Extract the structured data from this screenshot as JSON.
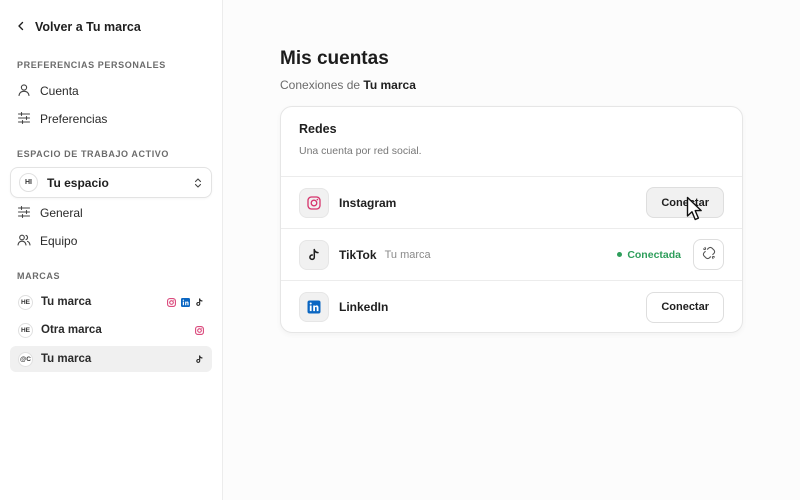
{
  "sidebar": {
    "back_label": "Volver a Tu marca",
    "personal_section": "PREFERENCIAS PERSONALES",
    "personal_items": [
      {
        "label": "Cuenta",
        "icon": "user-icon"
      },
      {
        "label": "Preferencias",
        "icon": "sliders-icon"
      }
    ],
    "workspace_section": "ESPACIO DE TRABAJO ACTIVO",
    "workspace": {
      "badge": "HI",
      "name": "Tu espacio"
    },
    "workspace_items": [
      {
        "label": "General",
        "icon": "sliders-icon"
      },
      {
        "label": "Equipo",
        "icon": "users-icon"
      }
    ],
    "brands_section": "MARCAS",
    "brands": [
      {
        "badge": "HE",
        "name": "Tu marca",
        "icons": [
          "instagram-icon",
          "linkedin-icon",
          "tiktok-icon"
        ]
      },
      {
        "badge": "HE",
        "name": "Otra marca",
        "icons": [
          "instagram-icon"
        ]
      },
      {
        "badge": "@C",
        "name": "Tu marca",
        "icons": [
          "tiktok-icon"
        ],
        "active": true
      }
    ]
  },
  "main": {
    "title": "Mis cuentas",
    "subtitle_prefix": "Conexiones de",
    "subtitle_brand": "Tu marca",
    "card": {
      "title": "Redes",
      "description": "Una cuenta por red social.",
      "rows": [
        {
          "name": "Instagram",
          "icon": "instagram-icon",
          "action": "Conectar"
        },
        {
          "name": "TikTok",
          "icon": "tiktok-icon",
          "account": "Tu marca",
          "status": "Conectada",
          "action_icon": "unlink-icon"
        },
        {
          "name": "LinkedIn",
          "icon": "linkedin-icon",
          "action": "Conectar"
        }
      ]
    }
  },
  "colors": {
    "instagram": "#d6336c",
    "linkedin": "#0a66c2",
    "connected": "#2e9e5b"
  }
}
